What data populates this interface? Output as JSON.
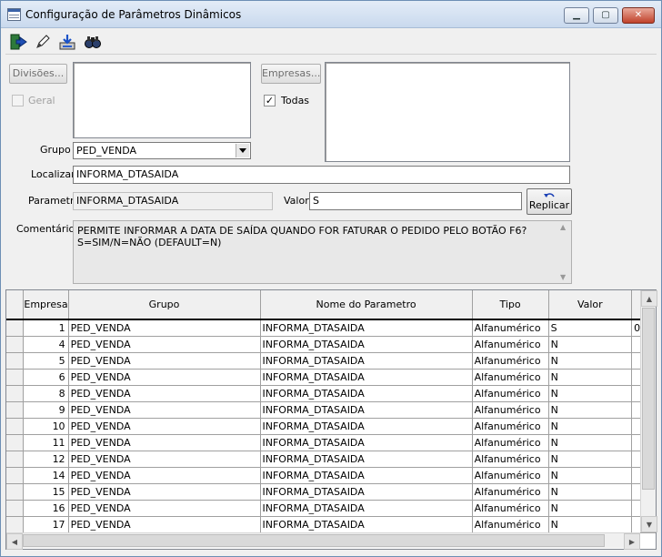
{
  "window": {
    "title": "Configuração de Parâmetros Dinâmicos"
  },
  "toolbar": {
    "buttons": [
      "exit-icon",
      "edit-icon",
      "save-icon",
      "search-icon"
    ]
  },
  "divisoes": {
    "button_label": "Divisões...",
    "geral_label": "Geral",
    "geral_checked": false
  },
  "empresas": {
    "button_label": "Empresas...",
    "todas_label": "Todas",
    "todas_checked": true
  },
  "grupo": {
    "label": "Grupo",
    "value": "PED_VENDA"
  },
  "localizar": {
    "label": "Localizar",
    "value": "INFORMA_DTASAIDA"
  },
  "parametro": {
    "label": "Parametro",
    "value": "INFORMA_DTASAIDA"
  },
  "valor": {
    "label": "Valor",
    "value": "S"
  },
  "replicar": {
    "label": "Replicar"
  },
  "comentarios": {
    "label": "Comentários",
    "line1": "PERMITE INFORMAR A DATA DE SAÍDA QUANDO FOR FATURAR O PEDIDO PELO BOTÃO F6?",
    "line2": "S=SIM/N=NÃO (DEFAULT=N)"
  },
  "grid": {
    "columns": [
      "Empresa",
      "Grupo",
      "Nome do Parametro",
      "Tipo",
      "Valor"
    ],
    "rows": [
      {
        "empresa": "1",
        "grupo": "PED_VENDA",
        "parametro": "INFORMA_DTASAIDA",
        "tipo": "Alfanumérico",
        "valor": "S",
        "extra": "0"
      },
      {
        "empresa": "4",
        "grupo": "PED_VENDA",
        "parametro": "INFORMA_DTASAIDA",
        "tipo": "Alfanumérico",
        "valor": "N",
        "extra": ""
      },
      {
        "empresa": "5",
        "grupo": "PED_VENDA",
        "parametro": "INFORMA_DTASAIDA",
        "tipo": "Alfanumérico",
        "valor": "N",
        "extra": ""
      },
      {
        "empresa": "6",
        "grupo": "PED_VENDA",
        "parametro": "INFORMA_DTASAIDA",
        "tipo": "Alfanumérico",
        "valor": "N",
        "extra": ""
      },
      {
        "empresa": "8",
        "grupo": "PED_VENDA",
        "parametro": "INFORMA_DTASAIDA",
        "tipo": "Alfanumérico",
        "valor": "N",
        "extra": ""
      },
      {
        "empresa": "9",
        "grupo": "PED_VENDA",
        "parametro": "INFORMA_DTASAIDA",
        "tipo": "Alfanumérico",
        "valor": "N",
        "extra": ""
      },
      {
        "empresa": "10",
        "grupo": "PED_VENDA",
        "parametro": "INFORMA_DTASAIDA",
        "tipo": "Alfanumérico",
        "valor": "N",
        "extra": ""
      },
      {
        "empresa": "11",
        "grupo": "PED_VENDA",
        "parametro": "INFORMA_DTASAIDA",
        "tipo": "Alfanumérico",
        "valor": "N",
        "extra": ""
      },
      {
        "empresa": "12",
        "grupo": "PED_VENDA",
        "parametro": "INFORMA_DTASAIDA",
        "tipo": "Alfanumérico",
        "valor": "N",
        "extra": ""
      },
      {
        "empresa": "14",
        "grupo": "PED_VENDA",
        "parametro": "INFORMA_DTASAIDA",
        "tipo": "Alfanumérico",
        "valor": "N",
        "extra": ""
      },
      {
        "empresa": "15",
        "grupo": "PED_VENDA",
        "parametro": "INFORMA_DTASAIDA",
        "tipo": "Alfanumérico",
        "valor": "N",
        "extra": ""
      },
      {
        "empresa": "16",
        "grupo": "PED_VENDA",
        "parametro": "INFORMA_DTASAIDA",
        "tipo": "Alfanumérico",
        "valor": "N",
        "extra": ""
      },
      {
        "empresa": "17",
        "grupo": "PED_VENDA",
        "parametro": "INFORMA_DTASAIDA",
        "tipo": "Alfanumérico",
        "valor": "N",
        "extra": ""
      }
    ]
  }
}
